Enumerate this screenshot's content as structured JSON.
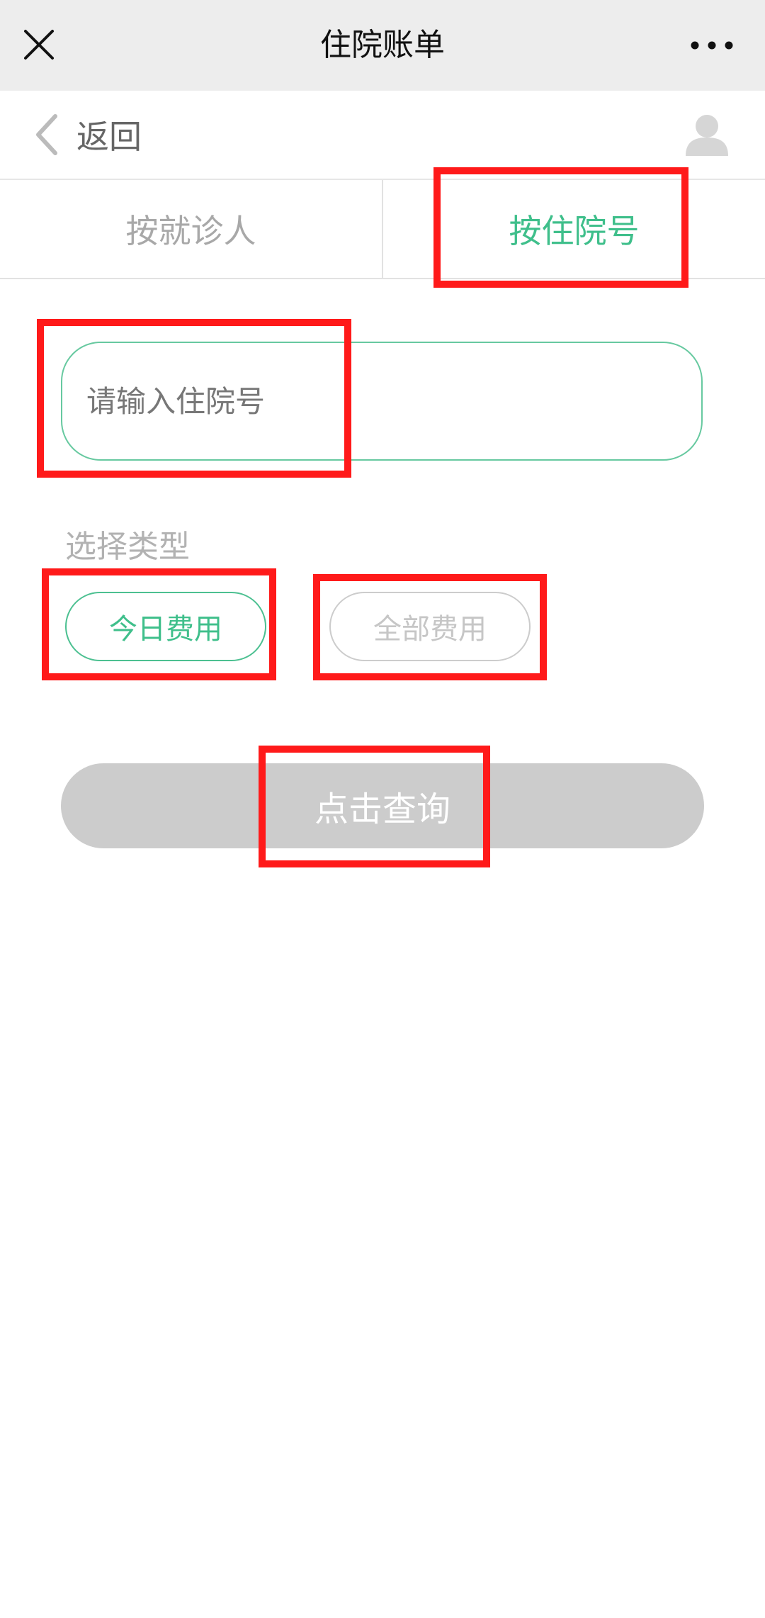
{
  "header": {
    "title": "住院账单"
  },
  "nav": {
    "back_label": "返回"
  },
  "tabs": [
    {
      "label": "按就诊人",
      "active": false
    },
    {
      "label": "按住院号",
      "active": true
    }
  ],
  "form": {
    "hospital_number": {
      "value": "",
      "placeholder": "请输入住院号"
    },
    "type_label": "选择类型",
    "type_options": [
      {
        "label": "今日费用",
        "selected": true
      },
      {
        "label": "全部费用",
        "selected": false
      }
    ],
    "submit_label": "点击查询"
  },
  "colors": {
    "accent": "#3fbf8b",
    "titlebar_bg": "#ededed",
    "disabled_button": "#cccccc",
    "annotation": "#ff1a1a"
  },
  "icons": {
    "close": "close-icon",
    "more": "more-icon",
    "back": "chevron-left-icon",
    "user": "user-icon"
  }
}
